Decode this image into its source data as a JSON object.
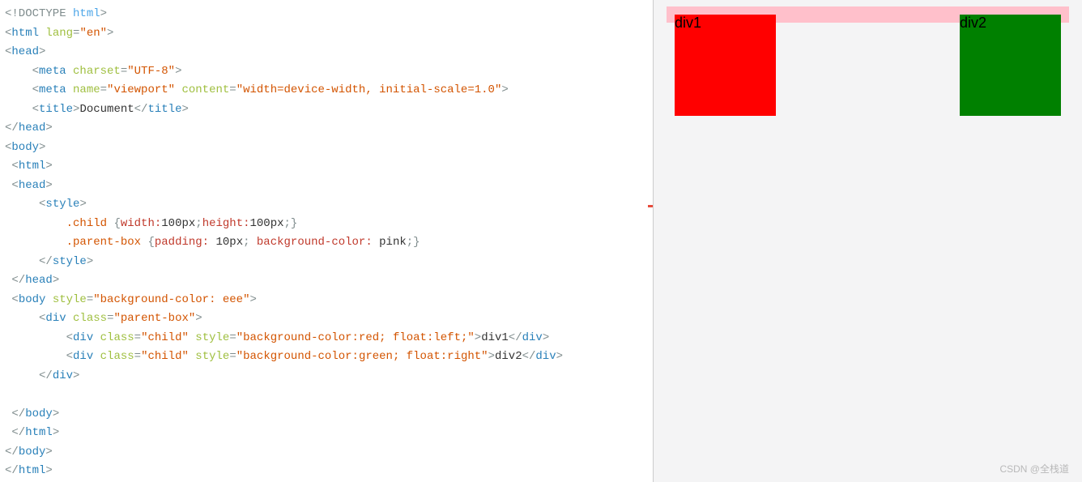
{
  "code": {
    "l1_doctype": "<!DOCTYPE ",
    "l1_html": "html",
    "l1_close": ">",
    "l2_open": "<",
    "l2_tag": "html",
    "l2_attr_name": " lang",
    "l2_eq": "=",
    "l2_attr_val": "\"en\"",
    "l2_close": ">",
    "l3_open": "<",
    "l3_tag": "head",
    "l3_close": ">",
    "l4_indent": "    ",
    "l4_open": "<",
    "l4_tag": "meta",
    "l4_attr1_name": " charset",
    "l4_eq": "=",
    "l4_attr1_val": "\"UTF-8\"",
    "l4_close": ">",
    "l5_indent": "    ",
    "l5_open": "<",
    "l5_tag": "meta",
    "l5_attr1_name": " name",
    "l5_eq1": "=",
    "l5_attr1_val": "\"viewport\"",
    "l5_attr2_name": " content",
    "l5_eq2": "=",
    "l5_attr2_val": "\"width=device-width, initial-scale=1.0\"",
    "l5_close": ">",
    "l6_indent": "    ",
    "l6_open": "<",
    "l6_tag": "title",
    "l6_close1": ">",
    "l6_text": "Document",
    "l6_open2": "</",
    "l6_tag2": "title",
    "l6_close2": ">",
    "l7_open": "</",
    "l7_tag": "head",
    "l7_close": ">",
    "l8_open": "<",
    "l8_tag": "body",
    "l8_close": ">",
    "l9_indent": " ",
    "l9_open": "<",
    "l9_tag": "html",
    "l9_close": ">",
    "l10_indent": " ",
    "l10_open": "<",
    "l10_tag": "head",
    "l10_close": ">",
    "l11_indent": "     ",
    "l11_open": "<",
    "l11_tag": "style",
    "l11_close": ">",
    "l12_indent": "         ",
    "l12_sel": ".child ",
    "l12_brace1": "{",
    "l12_prop1": "width:",
    "l12_val1": "100px",
    "l12_semi1": ";",
    "l12_prop2": "height:",
    "l12_val2": "100px",
    "l12_semi2": ";",
    "l12_brace2": "}",
    "l13_indent": "         ",
    "l13_sel": ".parent-box ",
    "l13_brace1": "{",
    "l13_prop1": "padding: ",
    "l13_val1": "10px",
    "l13_semi1": "; ",
    "l13_prop2": "background-color: ",
    "l13_val2": "pink",
    "l13_semi2": ";",
    "l13_brace2": "}",
    "l14_indent": "     ",
    "l14_open": "</",
    "l14_tag": "style",
    "l14_close": ">",
    "l15_indent": " ",
    "l15_open": "</",
    "l15_tag": "head",
    "l15_close": ">",
    "l16_indent": " ",
    "l16_open": "<",
    "l16_tag": "body",
    "l16_attr_name": " style",
    "l16_eq": "=",
    "l16_attr_val": "\"background-color: eee\"",
    "l16_close": ">",
    "l17_indent": "     ",
    "l17_open": "<",
    "l17_tag": "div",
    "l17_attr_name": " class",
    "l17_eq": "=",
    "l17_attr_val": "\"parent-box\"",
    "l17_close": ">",
    "l18_indent": "         ",
    "l18_open": "<",
    "l18_tag": "div",
    "l18_a1n": " class",
    "l18_eq1": "=",
    "l18_a1v": "\"child\"",
    "l18_a2n": " style",
    "l18_eq2": "=",
    "l18_a2v": "\"background-color:red; float:left;\"",
    "l18_close1": ">",
    "l18_text": "div1",
    "l18_open2": "</",
    "l18_tag2": "div",
    "l18_close2": ">",
    "l19_indent": "         ",
    "l19_open": "<",
    "l19_tag": "div",
    "l19_a1n": " class",
    "l19_eq1": "=",
    "l19_a1v": "\"child\"",
    "l19_a2n": " style",
    "l19_eq2": "=",
    "l19_a2v": "\"background-color:green; float:right\"",
    "l19_close1": ">",
    "l19_text": "div2",
    "l19_open2": "</",
    "l19_tag2": "div",
    "l19_close2": ">",
    "l20_indent": "     ",
    "l20_open": "</",
    "l20_tag": "div",
    "l20_close": ">",
    "l21_empty": " ",
    "l22_indent": " ",
    "l22_open": "</",
    "l22_tag": "body",
    "l22_close": ">",
    "l23_indent": " ",
    "l23_open": "</",
    "l23_tag": "html",
    "l23_close": ">",
    "l24_open": "</",
    "l24_tag": "body",
    "l24_close": ">",
    "l25_open": "</",
    "l25_tag": "html",
    "l25_close": ">"
  },
  "preview": {
    "div1_label": "div1",
    "div2_label": "div2"
  },
  "watermark": "CSDN @全栈道"
}
